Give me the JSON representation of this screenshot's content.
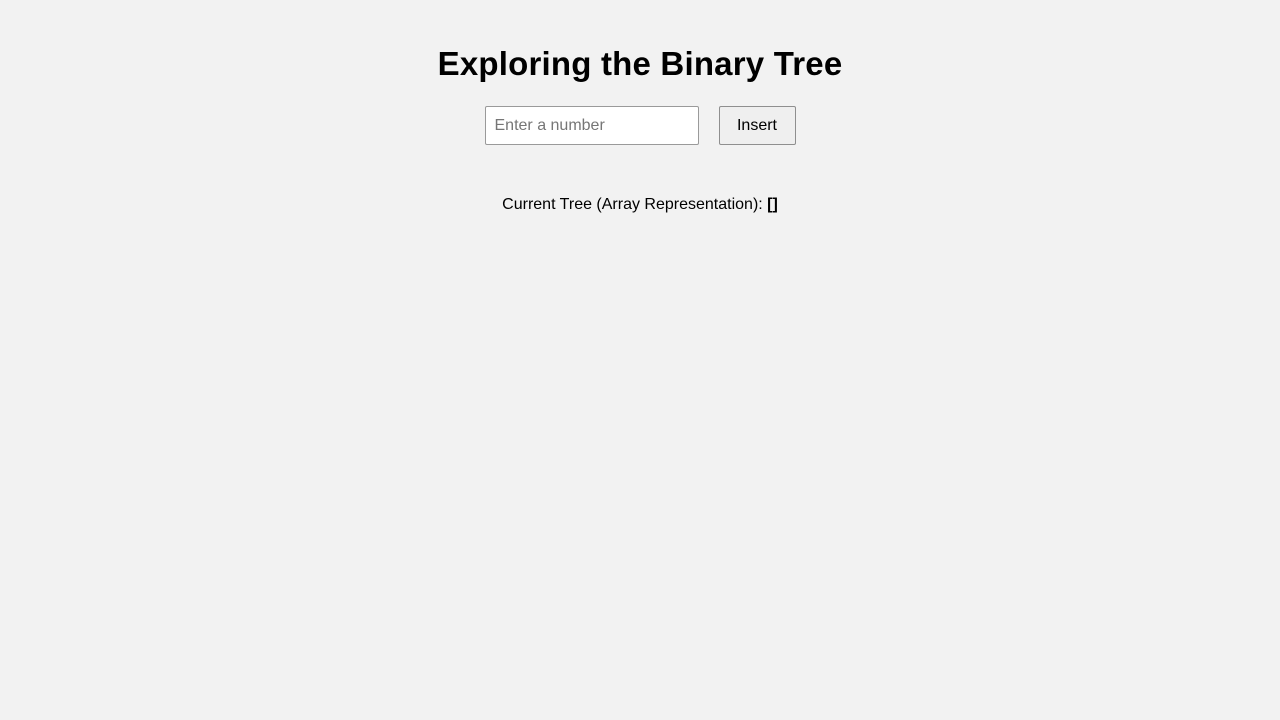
{
  "page": {
    "title": "Exploring the Binary Tree"
  },
  "controls": {
    "number_input": {
      "value": "",
      "placeholder": "Enter a number"
    },
    "insert_label": "Insert"
  },
  "tree_output": {
    "label": "Current Tree (Array Representation):",
    "value": "[]"
  },
  "colors": {
    "background": "#f2f2f2",
    "input_background": "#ffffff",
    "button_background": "#efefef",
    "text": "#000000"
  }
}
